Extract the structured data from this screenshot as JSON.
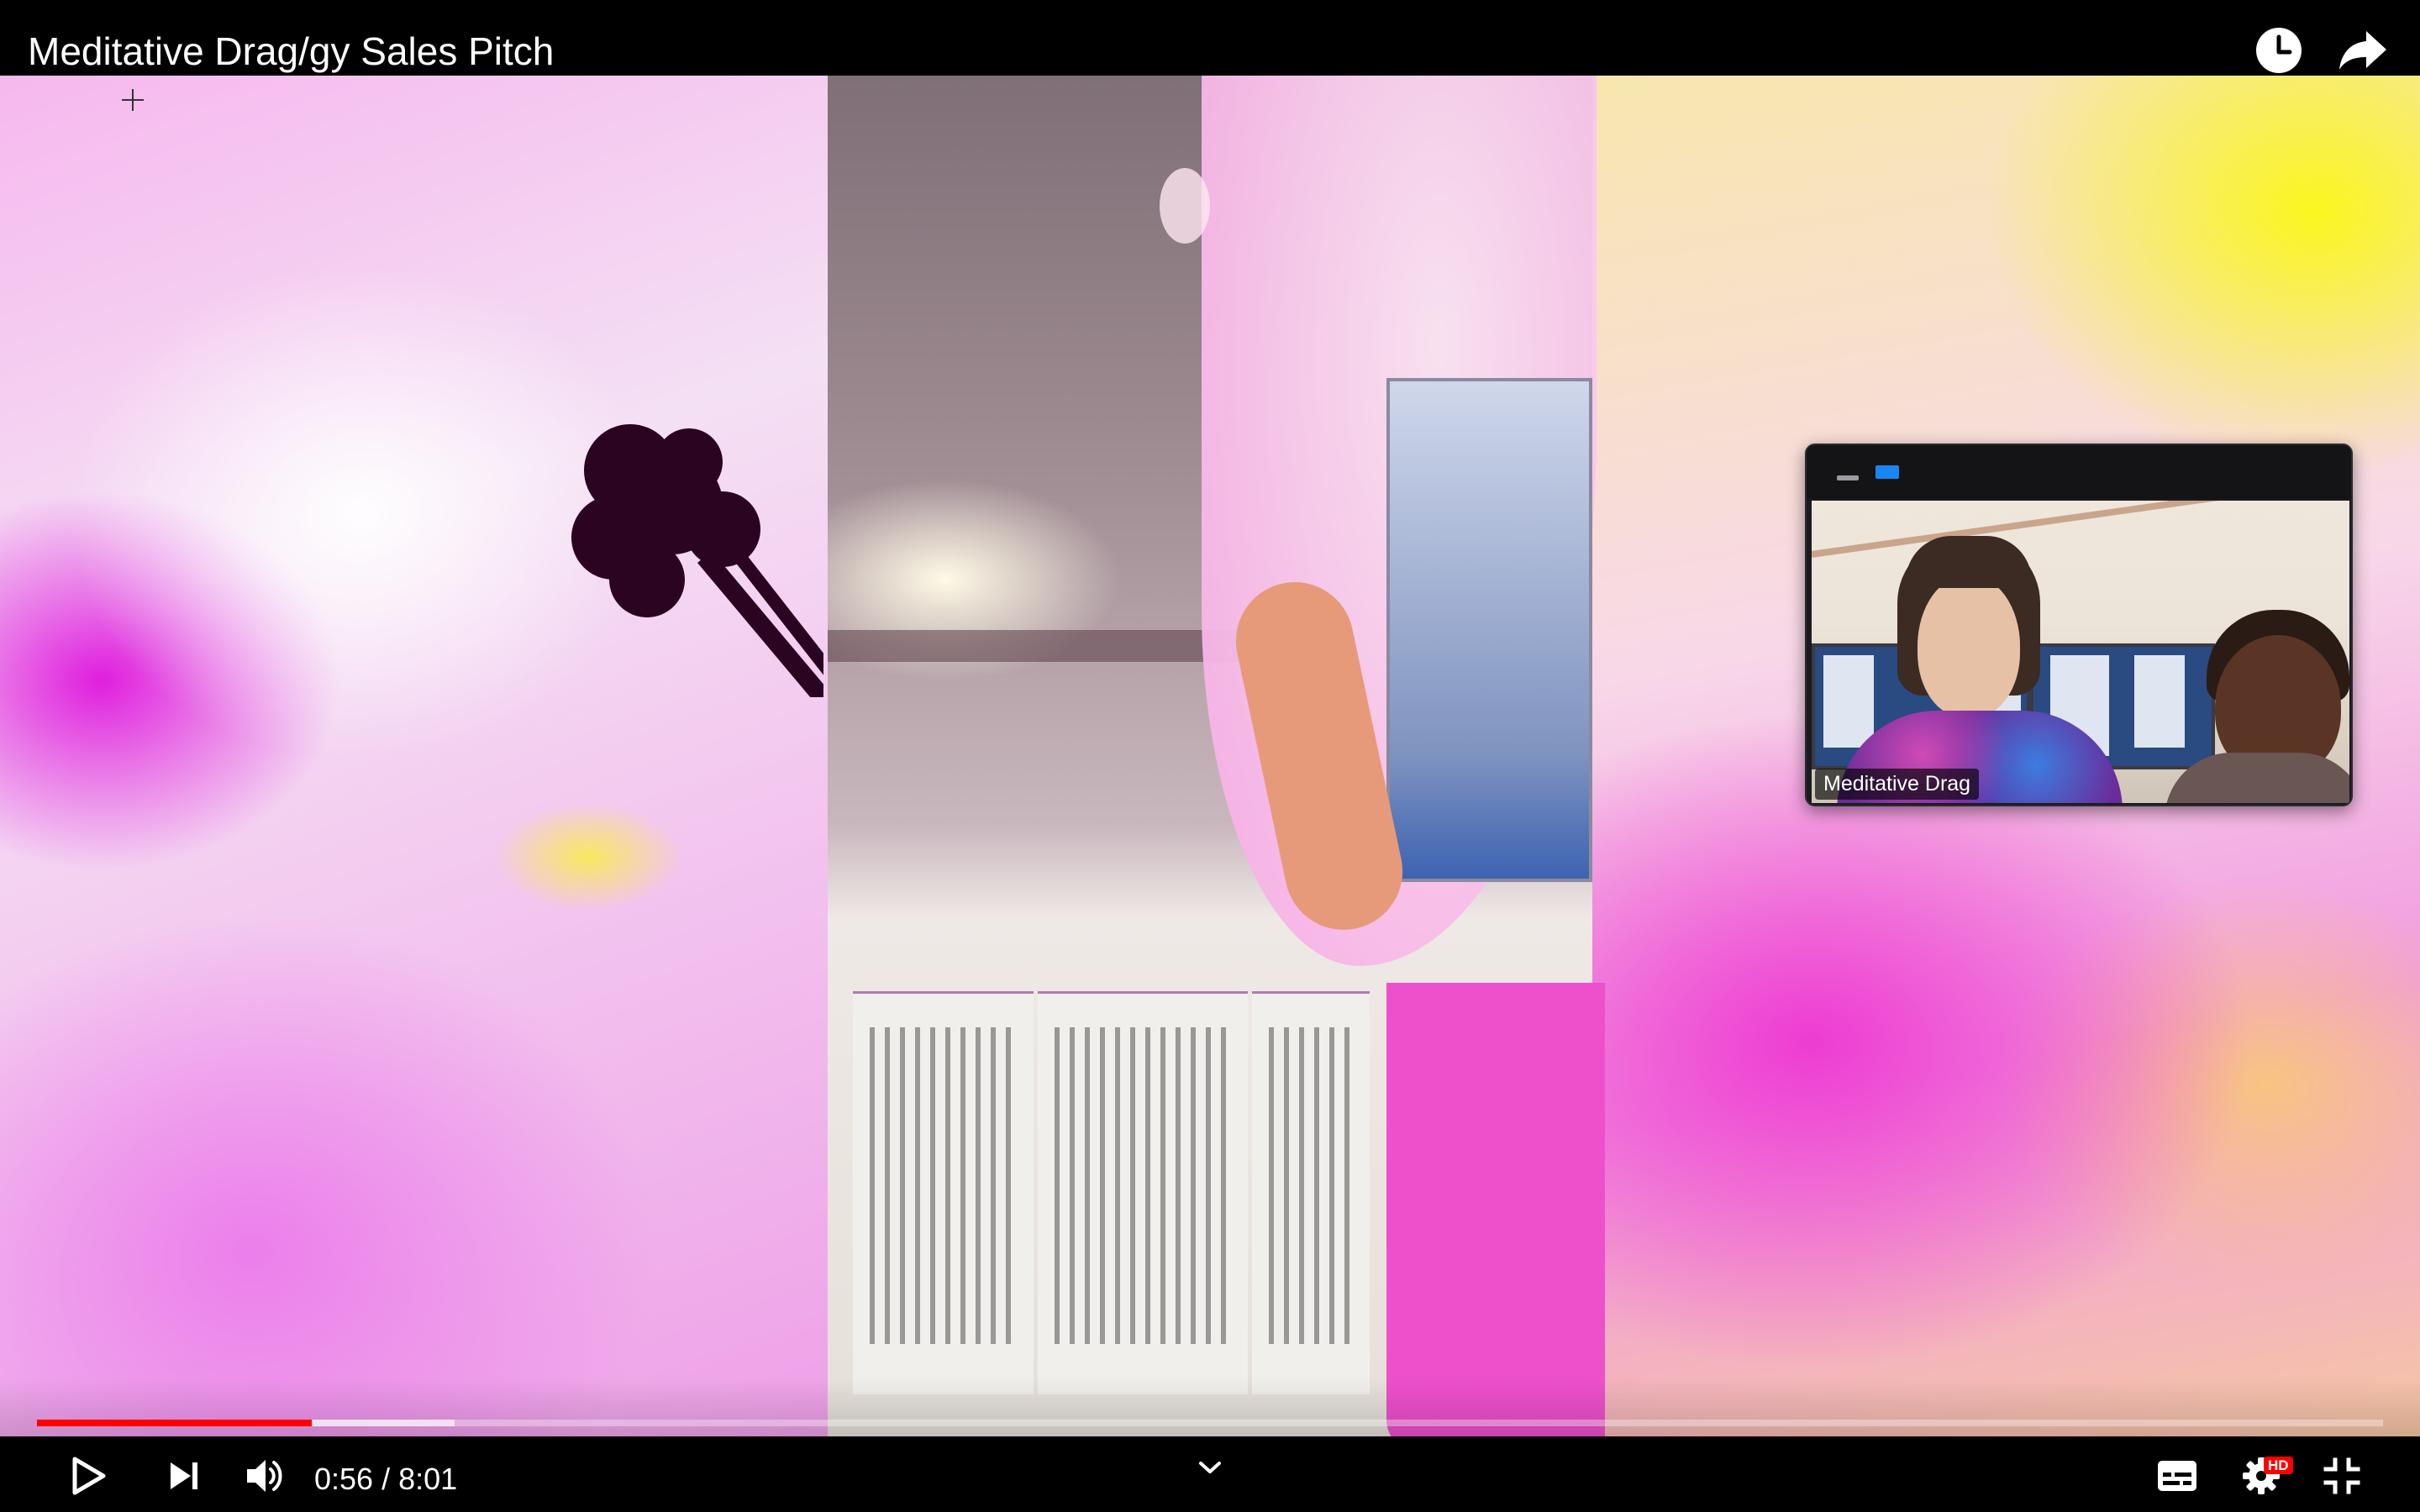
{
  "video": {
    "title": "Meditative Drag/gy Sales Pitch"
  },
  "meeting_overlay": {
    "participant_name": "Meditative Drag"
  },
  "player": {
    "current_time": "0:56",
    "duration": "8:01",
    "time_separator": "/",
    "played_fraction": 0.117,
    "buffered_fraction": 0.178,
    "quality_badge": "HD",
    "accent_color": "#ff0000"
  },
  "icons": {
    "top_right": [
      "clock-icon",
      "share-arrow-icon"
    ],
    "controls_left": [
      "play-icon",
      "next-icon",
      "volume-icon"
    ],
    "controls_center": [
      "chevron-down-icon"
    ],
    "controls_right": [
      "captions-icon",
      "settings-gear-icon",
      "exit-fullscreen-icon"
    ]
  }
}
